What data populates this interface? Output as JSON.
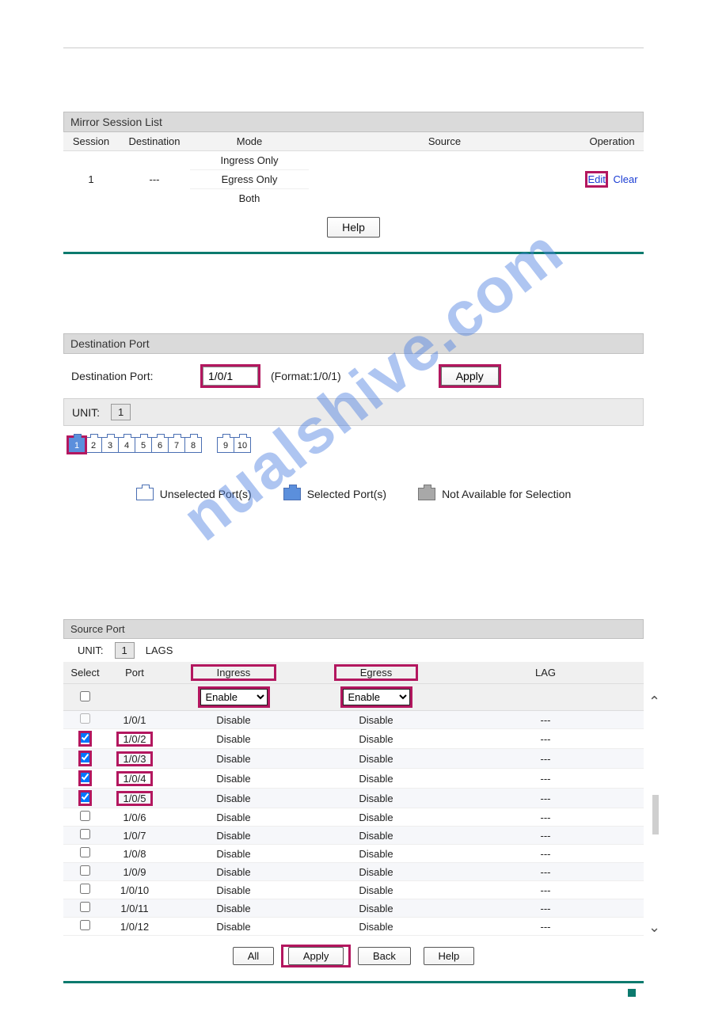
{
  "watermark": "nualshive.com",
  "session_list": {
    "title": "Mirror Session List",
    "headers": {
      "session": "Session",
      "dest": "Destination",
      "mode": "Mode",
      "source": "Source",
      "op": "Operation"
    },
    "rows": [
      {
        "session": "1",
        "dest": "---",
        "modes": [
          "Ingress Only",
          "Egress Only",
          "Both"
        ],
        "edit": "Edit",
        "clear": "Clear"
      }
    ],
    "help": "Help"
  },
  "dest_port": {
    "title": "Destination Port",
    "label": "Destination Port:",
    "value": "1/0/1",
    "format": "(Format:1/0/1)",
    "apply": "Apply",
    "unit_label": "UNIT:",
    "unit_value": "1",
    "ports_a": [
      "1",
      "2",
      "3",
      "4",
      "5",
      "6",
      "7",
      "8"
    ],
    "ports_b": [
      "9",
      "10"
    ],
    "legend": {
      "unsel": "Unselected Port(s)",
      "sel": "Selected Port(s)",
      "na": "Not Available for Selection"
    }
  },
  "source_port": {
    "title": "Source Port",
    "unit_label": "UNIT:",
    "unit_value": "1",
    "lags": "LAGS",
    "headers": {
      "select": "Select",
      "port": "Port",
      "ingress": "Ingress",
      "egress": "Egress",
      "lag": "LAG"
    },
    "ingress_sel": "Enable",
    "egress_sel": "Enable",
    "rows": [
      {
        "sel": false,
        "port": "1/0/1",
        "ingress": "Disable",
        "egress": "Disable",
        "lag": "---",
        "ghost": true
      },
      {
        "sel": true,
        "port": "1/0/2",
        "ingress": "Disable",
        "egress": "Disable",
        "lag": "---"
      },
      {
        "sel": true,
        "port": "1/0/3",
        "ingress": "Disable",
        "egress": "Disable",
        "lag": "---"
      },
      {
        "sel": true,
        "port": "1/0/4",
        "ingress": "Disable",
        "egress": "Disable",
        "lag": "---"
      },
      {
        "sel": true,
        "port": "1/0/5",
        "ingress": "Disable",
        "egress": "Disable",
        "lag": "---"
      },
      {
        "sel": false,
        "port": "1/0/6",
        "ingress": "Disable",
        "egress": "Disable",
        "lag": "---"
      },
      {
        "sel": false,
        "port": "1/0/7",
        "ingress": "Disable",
        "egress": "Disable",
        "lag": "---"
      },
      {
        "sel": false,
        "port": "1/0/8",
        "ingress": "Disable",
        "egress": "Disable",
        "lag": "---"
      },
      {
        "sel": false,
        "port": "1/0/9",
        "ingress": "Disable",
        "egress": "Disable",
        "lag": "---"
      },
      {
        "sel": false,
        "port": "1/0/10",
        "ingress": "Disable",
        "egress": "Disable",
        "lag": "---"
      },
      {
        "sel": false,
        "port": "1/0/11",
        "ingress": "Disable",
        "egress": "Disable",
        "lag": "---"
      },
      {
        "sel": false,
        "port": "1/0/12",
        "ingress": "Disable",
        "egress": "Disable",
        "lag": "---"
      }
    ],
    "buttons": {
      "all": "All",
      "apply": "Apply",
      "back": "Back",
      "help": "Help"
    }
  }
}
